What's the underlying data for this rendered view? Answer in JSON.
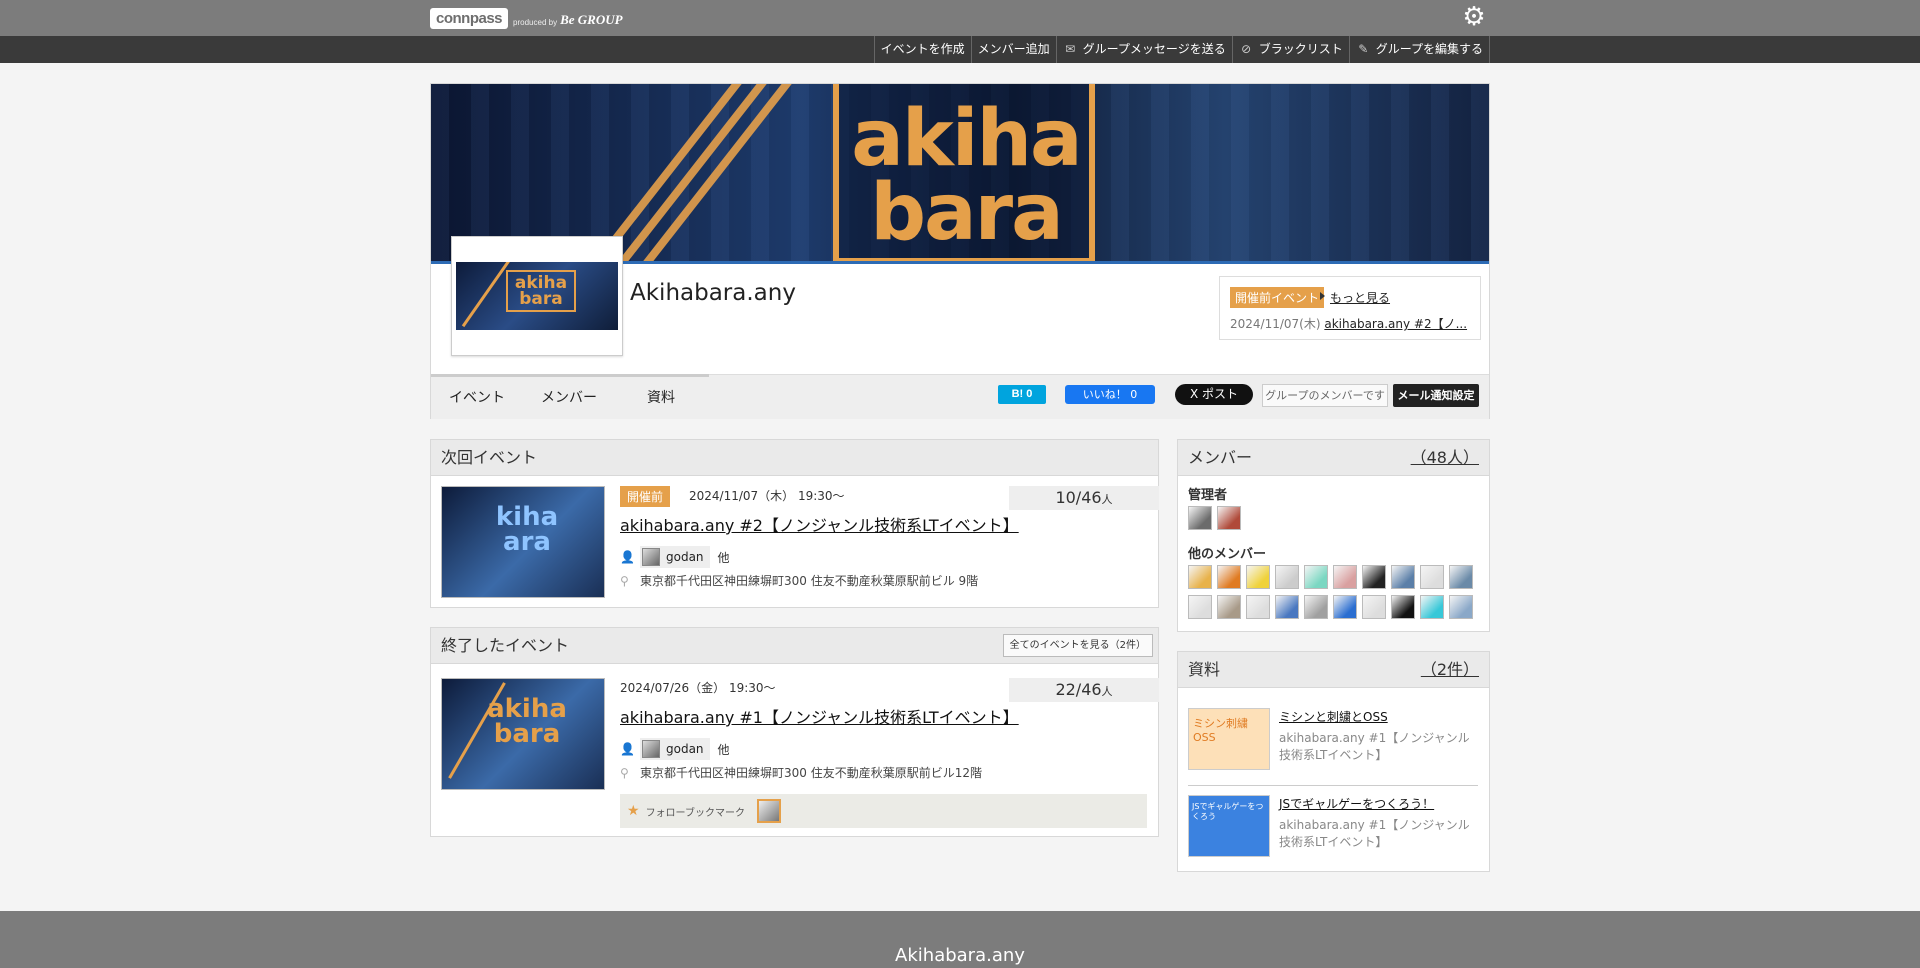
{
  "header": {
    "logo_text": "connpass",
    "produced_by": "produced by",
    "logo_group": "Be GROUP",
    "settings_icon": "gear-icon"
  },
  "admin_menu": [
    {
      "label": "イベントを作成",
      "icon": ""
    },
    {
      "label": "メンバー追加",
      "icon": ""
    },
    {
      "label": "グループメッセージを送る",
      "icon": "envelope-icon"
    },
    {
      "label": "ブラックリスト",
      "icon": "block-icon"
    },
    {
      "label": "グループを編集する",
      "icon": "edit-icon"
    }
  ],
  "group": {
    "banner_text_1": "akiha",
    "banner_text_2": "bara",
    "thumb_text": "akiha bara",
    "name": "Akihabara.any",
    "next_event": {
      "badge": "開催前イベント",
      "more": "もっと見る",
      "date": "2024/11/07(木)",
      "title": "akihabara.any #2【ノ..."
    },
    "tabs": [
      "イベント",
      "メンバー",
      "資料"
    ],
    "share": {
      "hatena": "B! 0",
      "facebook": "いいね！ 0",
      "x": "X ポスト",
      "member_status": "グループのメンバーです",
      "mail_settings": "メール通知設定"
    }
  },
  "next_events": {
    "heading": "次回イベント",
    "items": [
      {
        "badge": "開催前",
        "date": "2024/11/07（木） 19:30〜",
        "count": "10/46",
        "unit": "人",
        "title": "akihabara.any #2【ノンジャンル技術系LTイベント】",
        "organizer": "godan",
        "others": "他",
        "place": "東京都千代田区神田練塀町300 住友不動産秋葉原駅前ビル 9階",
        "image_text": "kiha ara"
      }
    ]
  },
  "past_events": {
    "heading": "終了したイベント",
    "all_button": "全てのイベントを見る（2件）",
    "items": [
      {
        "date": "2024/07/26（金） 19:30〜",
        "count": "22/46",
        "unit": "人",
        "title": "akihabara.any #1【ノンジャンル技術系LTイベント】",
        "organizer": "godan",
        "others": "他",
        "place": "東京都千代田区神田練塀町300 住友不動産秋葉原駅前ビル12階",
        "follow_label": "フォローブックマーク",
        "image_text": "akiha bara"
      }
    ]
  },
  "members": {
    "heading": "メンバー",
    "count": "（48人）",
    "admins_label": "管理者",
    "others_label": "他のメンバー",
    "admin_avatars": [
      "#6b6b6b",
      "#b04a3a"
    ],
    "member_avatars": [
      "#e8b24a",
      "#e07b22",
      "#f0d23a",
      "#cccccc",
      "#7bd7c2",
      "#d9a0a0",
      "#222222",
      "#5b7fa8",
      "#dddddd",
      "#6a8aa8",
      "#dddddd",
      "#a89a88",
      "#dddddd",
      "#4a78c0",
      "#a0a0a0",
      "#2b6ed0",
      "#dddddd",
      "#111111",
      "#38c8d8",
      "#8aa8c8"
    ]
  },
  "documents": {
    "heading": "資料",
    "count": "（2件）",
    "items": [
      {
        "title": "ミシンと刺繍とOSS",
        "subtitle": "akihabara.any #1【ノンジャンル技術系LTイベント】",
        "thumb_color": "#fde0b8",
        "thumb_text": "ミシン刺繍OSS"
      },
      {
        "title": "JSでギャルゲーをつくろう！",
        "subtitle": "akihabara.any #1【ノンジャンル技術系LTイベント】",
        "thumb_color": "#3b82e0",
        "thumb_text": "JSでギャルゲーをつくろう"
      }
    ]
  },
  "footer": {
    "title": "Akihabara.any"
  }
}
